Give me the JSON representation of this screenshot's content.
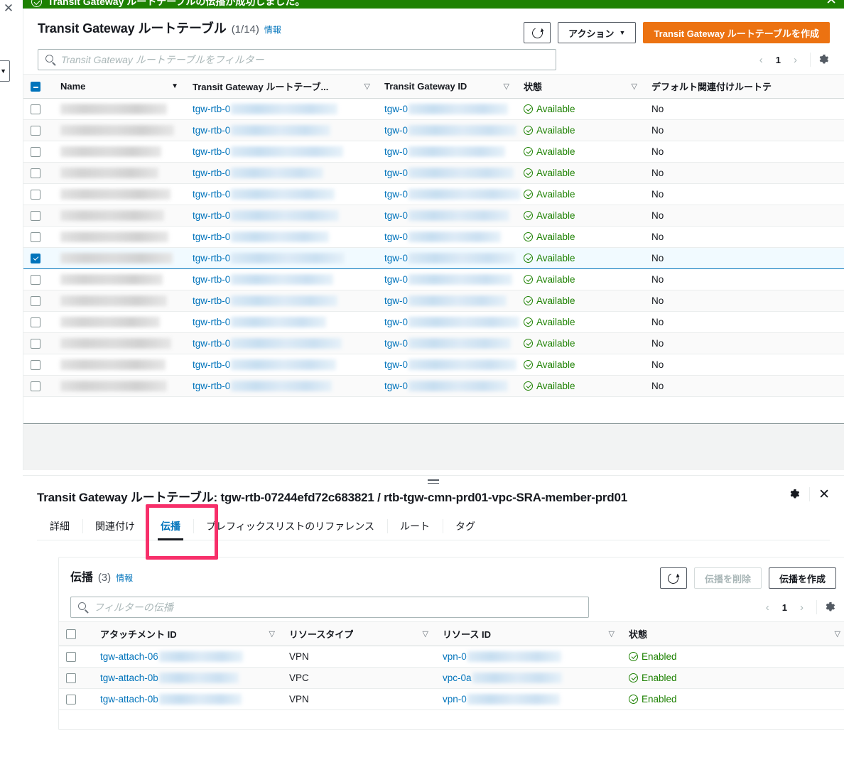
{
  "flash": {
    "message": "Transit Gateway ルートテーブルの伝播が成功しました。",
    "close_label": "✕",
    "bg_color": "#1d8102"
  },
  "edge": {
    "close_label": "✕",
    "dropdown_caret": "▼"
  },
  "list": {
    "title": "Transit Gateway ルートテーブル",
    "count": "(1/14)",
    "info_label": "情報",
    "refresh_label": "",
    "actions_label": "アクション",
    "actions_caret": "▼",
    "create_label": "Transit Gateway ルートテーブルを作成",
    "create_color": "#ec7211",
    "filter_placeholder": "Transit Gateway ルートテーブルをフィルター",
    "filter_value": "",
    "page_prev": "‹",
    "page_number": "1",
    "page_next": "›",
    "columns": [
      {
        "label": "Name",
        "sort": "filled"
      },
      {
        "label": "Transit Gateway ルートテーブ...",
        "sort": "hollow"
      },
      {
        "label": "Transit Gateway ID",
        "sort": "hollow"
      },
      {
        "label": "状態",
        "sort": "hollow"
      },
      {
        "label": "デフォルト関連付けルートテ",
        "sort": "none"
      }
    ],
    "rows": [
      {
        "name": "",
        "rtb_prefix": "tgw-rtb-0",
        "tgw_prefix": "tgw-0",
        "state": "Available",
        "default_assoc": "No",
        "selected": false
      },
      {
        "name": "",
        "rtb_prefix": "tgw-rtb-0",
        "tgw_prefix": "tgw-0",
        "state": "Available",
        "default_assoc": "No",
        "selected": false
      },
      {
        "name": "",
        "rtb_prefix": "tgw-rtb-0",
        "tgw_prefix": "tgw-0",
        "state": "Available",
        "default_assoc": "No",
        "selected": false
      },
      {
        "name": "",
        "rtb_prefix": "tgw-rtb-0",
        "tgw_prefix": "tgw-0",
        "state": "Available",
        "default_assoc": "No",
        "selected": false
      },
      {
        "name": "",
        "rtb_prefix": "tgw-rtb-0",
        "tgw_prefix": "tgw-0",
        "state": "Available",
        "default_assoc": "No",
        "selected": false
      },
      {
        "name": "",
        "rtb_prefix": "tgw-rtb-0",
        "tgw_prefix": "tgw-0",
        "state": "Available",
        "default_assoc": "No",
        "selected": false
      },
      {
        "name": "",
        "rtb_prefix": "tgw-rtb-0",
        "tgw_prefix": "tgw-0",
        "state": "Available",
        "default_assoc": "No",
        "selected": false
      },
      {
        "name": "",
        "rtb_prefix": "tgw-rtb-0",
        "tgw_prefix": "tgw-0",
        "state": "Available",
        "default_assoc": "No",
        "selected": true
      },
      {
        "name": "",
        "rtb_prefix": "tgw-rtb-0",
        "tgw_prefix": "tgw-0",
        "state": "Available",
        "default_assoc": "No",
        "selected": false
      },
      {
        "name": "",
        "rtb_prefix": "tgw-rtb-0",
        "tgw_prefix": "tgw-0",
        "state": "Available",
        "default_assoc": "No",
        "selected": false
      },
      {
        "name": "",
        "rtb_prefix": "tgw-rtb-0",
        "tgw_prefix": "tgw-0",
        "state": "Available",
        "default_assoc": "No",
        "selected": false
      },
      {
        "name": "",
        "rtb_prefix": "tgw-rtb-0",
        "tgw_prefix": "tgw-0",
        "state": "Available",
        "default_assoc": "No",
        "selected": false
      },
      {
        "name": "",
        "rtb_prefix": "tgw-rtb-0",
        "tgw_prefix": "tgw-0",
        "state": "Available",
        "default_assoc": "No",
        "selected": false
      },
      {
        "name": "",
        "rtb_prefix": "tgw-rtb-0",
        "tgw_prefix": "tgw-0",
        "state": "Available",
        "default_assoc": "No",
        "selected": false
      }
    ]
  },
  "detail": {
    "title": "Transit Gateway ルートテーブル: tgw-rtb-07244efd72c683821 / rtb-tgw-cmn-prd01-vpc-SRA-member-prd01",
    "close_label": "✕",
    "tabs": [
      {
        "label": "詳細",
        "active": false
      },
      {
        "label": "関連付け",
        "active": false
      },
      {
        "label": "伝播",
        "active": true
      },
      {
        "label": "プレフィックスリストのリファレンス",
        "active": false
      },
      {
        "label": "ルート",
        "active": false
      },
      {
        "label": "タグ",
        "active": false
      }
    ],
    "highlight_color": "#f72f6a",
    "propagation": {
      "title": "伝播",
      "count": "(3)",
      "info_label": "情報",
      "delete_label": "伝播を削除",
      "create_label": "伝播を作成",
      "filter_placeholder": "フィルターの伝播",
      "filter_value": "",
      "page_prev": "‹",
      "page_number": "1",
      "page_next": "›",
      "columns": [
        {
          "label": "アタッチメント ID",
          "sort": "hollow"
        },
        {
          "label": "リソースタイプ",
          "sort": "hollow"
        },
        {
          "label": "リソース ID",
          "sort": "hollow"
        },
        {
          "label": "状態",
          "sort": "hollow"
        }
      ],
      "rows": [
        {
          "attachment_prefix": "tgw-attach-06",
          "resource_type": "VPN",
          "resource_prefix": "vpn-0",
          "state": "Enabled"
        },
        {
          "attachment_prefix": "tgw-attach-0b",
          "resource_type": "VPC",
          "resource_prefix": "vpc-0a",
          "state": "Enabled"
        },
        {
          "attachment_prefix": "tgw-attach-0b",
          "resource_type": "VPN",
          "resource_prefix": "vpn-0",
          "state": "Enabled"
        }
      ]
    }
  }
}
